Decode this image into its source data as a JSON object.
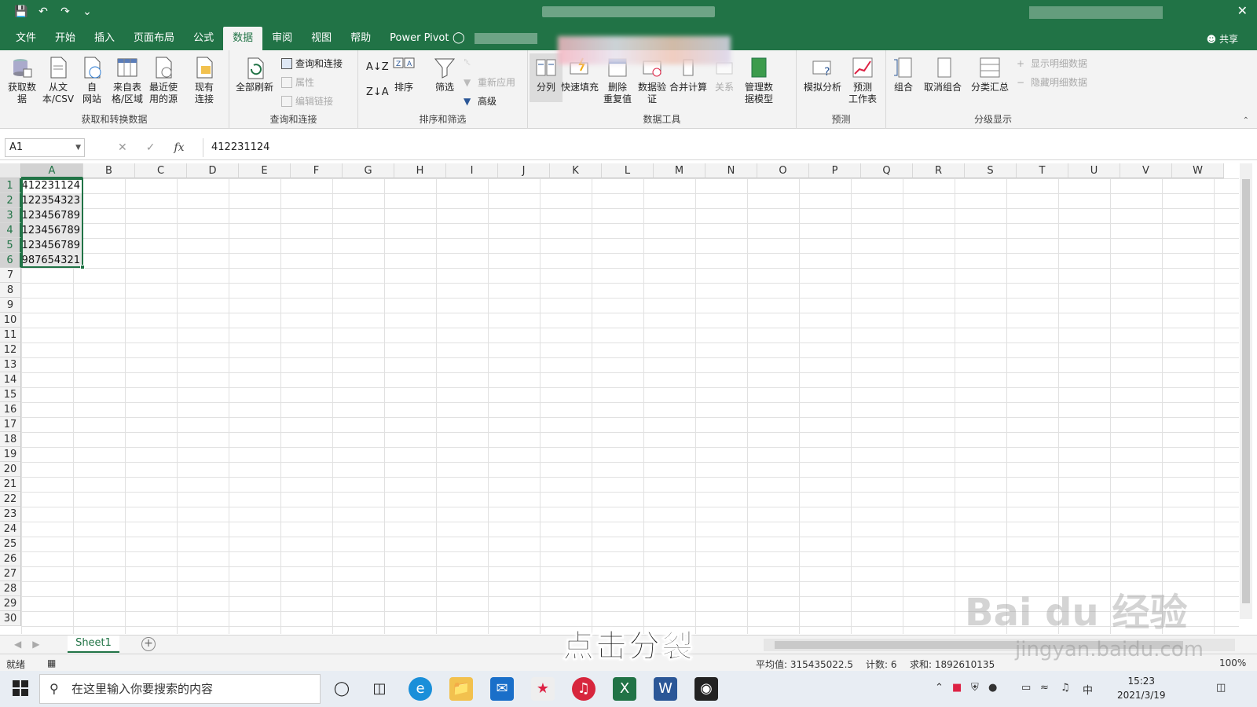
{
  "ribbon_tabs": [
    "文件",
    "开始",
    "插入",
    "页面布局",
    "公式",
    "数据",
    "审阅",
    "视图",
    "帮助",
    "Power Pivot"
  ],
  "active_tab": "数据",
  "share_label": "共享",
  "groups": {
    "get_transform": {
      "label": "获取和转换数据",
      "buttons": [
        "获取数\n据",
        "从文\n本/CSV",
        "自\n网站",
        "来自表\n格/区域",
        "最近使\n用的源",
        "现有\n连接"
      ]
    },
    "queries": {
      "label": "查询和连接",
      "refresh": "全部刷新",
      "items": [
        "查询和连接",
        "属性",
        "编辑链接"
      ]
    },
    "sort_filter": {
      "label": "排序和筛选",
      "sort": "排序",
      "filter": "筛选",
      "items": [
        "重新应用",
        "高级"
      ]
    },
    "data_tools": {
      "label": "数据工具",
      "buttons": [
        "分列",
        "快速填充",
        "删除\n重复值",
        "数据验\n证",
        "合并计算",
        "关系",
        "管理数\n据模型"
      ]
    },
    "forecast": {
      "label": "预测",
      "buttons": [
        "模拟分析",
        "预测\n工作表"
      ]
    },
    "outline": {
      "label": "分级显示",
      "buttons": [
        "组合",
        "取消组合",
        "分类汇总"
      ],
      "items": [
        "显示明细数据",
        "隐藏明细数据"
      ]
    }
  },
  "formula_bar": {
    "name_box": "A1",
    "fx": "fx",
    "formula": "412231124"
  },
  "columns": [
    "A",
    "B",
    "C",
    "D",
    "E",
    "F",
    "G",
    "H",
    "I",
    "J",
    "K",
    "L",
    "M",
    "N",
    "O",
    "P",
    "Q",
    "R",
    "S",
    "T",
    "U",
    "V",
    "W"
  ],
  "rows": [
    "1",
    "2",
    "3",
    "4",
    "5",
    "6",
    "7",
    "8",
    "9",
    "10",
    "11",
    "12",
    "13",
    "14",
    "15",
    "16",
    "17",
    "18",
    "19",
    "20",
    "21",
    "22",
    "23",
    "24",
    "25",
    "26",
    "27",
    "28",
    "29",
    "30"
  ],
  "cells_A": [
    "412231124",
    "122354323",
    "123456789",
    "123456789",
    "123456789",
    "987654321"
  ],
  "sheet_tab": "Sheet1",
  "status": {
    "ready": "就绪",
    "average": "平均值: 315435022.5",
    "count": "计数: 6",
    "sum": "求和: 1892610135",
    "zoom": "100%"
  },
  "caption": "点击分裂",
  "watermark": "Bai du 经验",
  "watermark_url": "jingyan.baidu.com",
  "taskbar": {
    "search_placeholder": "在这里输入你要搜索的内容",
    "time": "15:23",
    "date": "2021/3/19",
    "ime": "中"
  },
  "colors": {
    "excel_green": "#217346",
    "selection": "#217346"
  }
}
